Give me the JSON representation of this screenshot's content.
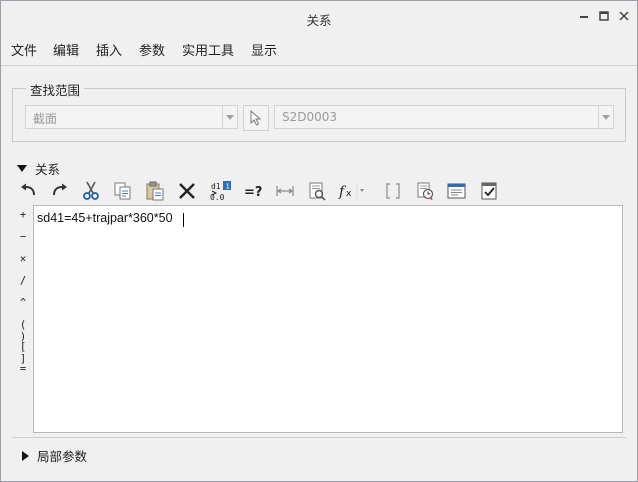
{
  "window": {
    "title": "关系"
  },
  "menu": {
    "items": [
      "文件",
      "编辑",
      "插入",
      "参数",
      "实用工具",
      "显示"
    ]
  },
  "search_scope": {
    "legend": "查找范围",
    "type_select": {
      "value": "截面"
    },
    "item_select": {
      "value": "S2D0003"
    }
  },
  "relations": {
    "header": "关系",
    "operators": [
      "+",
      "−",
      "×",
      "/",
      "^",
      "( )",
      "[ ]",
      "="
    ],
    "editor_text": "sd41=45+trajpar*360*50"
  },
  "local_params": {
    "header": "局部参数"
  },
  "colors": {
    "accent_blue": "#2a6ebb",
    "scissors_blue": "#1f5fa8",
    "warn_red": "#c0392b"
  },
  "icons": [
    "undo-icon",
    "redo-icon",
    "cut-icon",
    "copy-icon",
    "paste-icon",
    "delete-icon",
    "switch-dimensions-icon",
    "evaluate-icon",
    "measure-icon",
    "properties-icon",
    "insert-function-icon",
    "brackets-icon",
    "verify-icon",
    "sort-icon",
    "execute-icon"
  ]
}
